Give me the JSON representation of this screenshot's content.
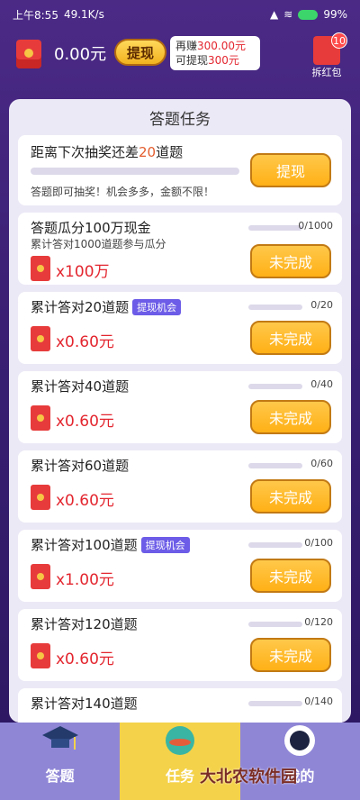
{
  "status_bar": {
    "time": "上午8:55",
    "speed": "49.1K/s",
    "icons_right": [
      "signal-icon",
      "wifi-icon"
    ],
    "battery": "99%"
  },
  "header": {
    "balance": "0.00元",
    "withdraw_label": "提现",
    "earn_line1_prefix": "再赚",
    "earn_line1_value": "300.00元",
    "earn_line2_prefix": "可提现",
    "earn_line2_value": "300元",
    "split_badge": "10",
    "split_label": "拆红包"
  },
  "panel": {
    "title": "答题任务",
    "progress_card": {
      "title_prefix": "距离下次抽奖还差",
      "title_num": "20",
      "title_suffix": "道题",
      "button_label": "提现",
      "sub_text": "答题即可抽奖！机会多多，金额不限！"
    },
    "tasks": [
      {
        "title": "答题瓜分100万现金",
        "sub": "累计答对1000道题参与瓜分",
        "badge": "",
        "count": "0/1000",
        "reward": "x100万",
        "button": "未完成"
      },
      {
        "title": "累计答对20道题",
        "sub": "",
        "badge": "提现机会",
        "count": "0/20",
        "reward": "x0.60元",
        "button": "未完成"
      },
      {
        "title": "累计答对40道题",
        "sub": "",
        "badge": "",
        "count": "0/40",
        "reward": "x0.60元",
        "button": "未完成"
      },
      {
        "title": "累计答对60道题",
        "sub": "",
        "badge": "",
        "count": "0/60",
        "reward": "x0.60元",
        "button": "未完成"
      },
      {
        "title": "累计答对100道题",
        "sub": "",
        "badge": "提现机会",
        "count": "0/100",
        "reward": "x1.00元",
        "button": "未完成"
      },
      {
        "title": "累计答对120道题",
        "sub": "",
        "badge": "",
        "count": "0/120",
        "reward": "x0.60元",
        "button": "未完成"
      },
      {
        "title": "累计答对140道题",
        "sub": "",
        "badge": "",
        "count": "0/140",
        "reward": "",
        "button": ""
      }
    ]
  },
  "bottom_nav": {
    "items": [
      {
        "label": "答题",
        "icon": "graduation-cap-icon"
      },
      {
        "label": "任务",
        "icon": "planet-ufo-icon"
      },
      {
        "label": "我的",
        "icon": "astronaut-icon"
      }
    ]
  },
  "watermark": "大北农软件园"
}
